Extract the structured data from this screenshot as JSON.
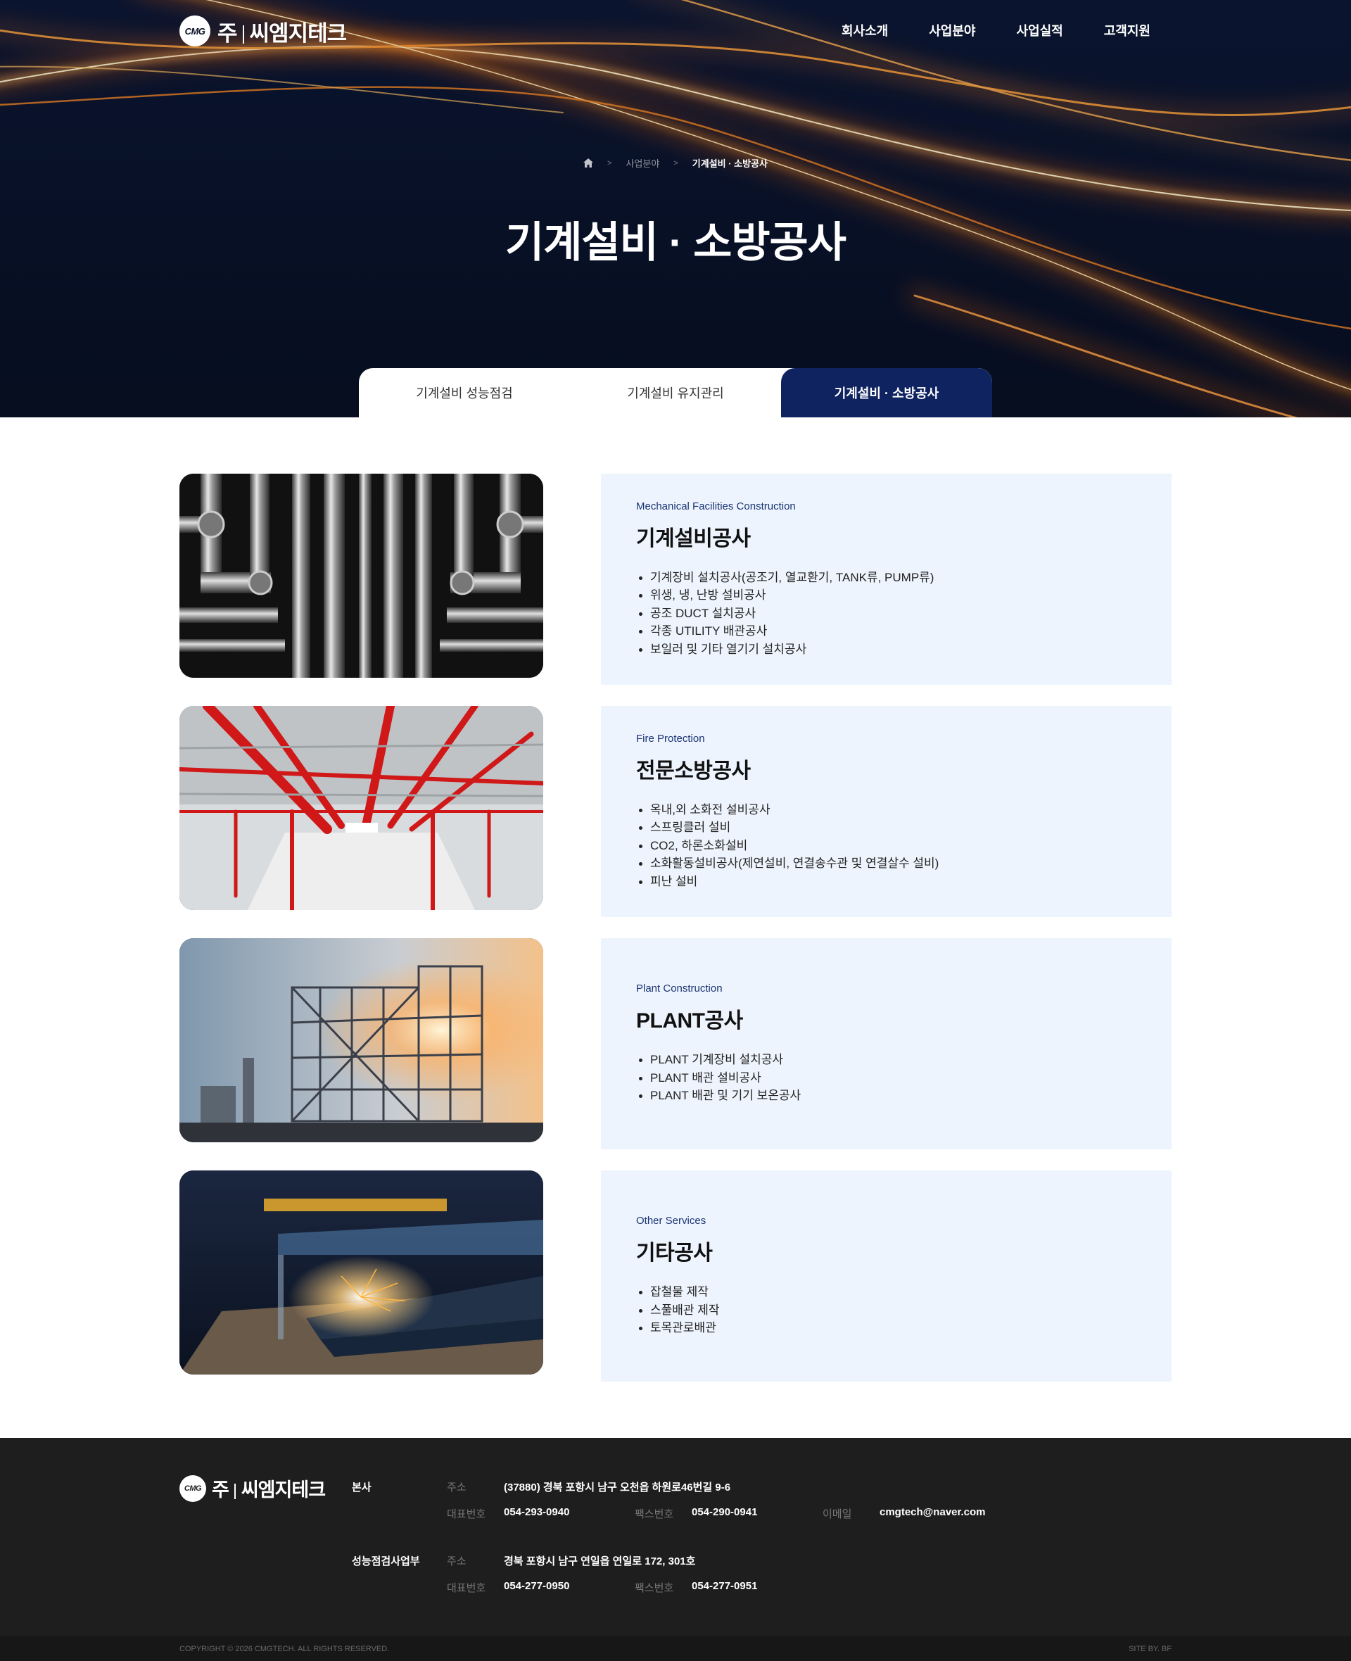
{
  "header": {
    "logo_mark": "CMG",
    "logo_text": "주",
    "logo_name": "씨엠지테크",
    "nav": [
      "회사소개",
      "사업분야",
      "사업실적",
      "고객지원"
    ]
  },
  "breadcrumb": {
    "items": [
      "사업분야",
      "기계설비 · 소방공사"
    ]
  },
  "page_title": "기계설비 · 소방공사",
  "tabs": [
    {
      "label": "기계설비 성능점검",
      "active": false
    },
    {
      "label": "기계설비 유지관리",
      "active": false
    },
    {
      "label": "기계설비 · 소방공사",
      "active": true
    }
  ],
  "services": [
    {
      "subtitle": "Mechanical Facilities Construction",
      "title": "기계설비공사",
      "items": [
        "기계장비 설치공사(공조기, 열교환기, TANK류, PUMP류)",
        "위생, 냉, 난방 설비공사",
        "공조 DUCT 설치공사",
        "각종 UTILITY 배관공사",
        "보일러 및 기타 열기기 설치공사"
      ]
    },
    {
      "subtitle": "Fire Protection",
      "title": "전문소방공사",
      "items": [
        "옥내,외 소화전 설비공사",
        "스프링클러 설비",
        "CO2, 하론소화설비",
        "소화활동설비공사(제연설비, 연결송수관 및 연결살수 설비)",
        "피난 설비"
      ]
    },
    {
      "subtitle": "Plant Construction",
      "title": "PLANT공사",
      "items": [
        "PLANT 기계장비 설치공사",
        "PLANT 배관 설비공사",
        "PLANT 배관 및 기기 보온공사"
      ]
    },
    {
      "subtitle": "Other Services",
      "title": "기타공사",
      "items": [
        "잡철물 제작",
        "스풀배관 제작",
        "토목관로배관"
      ]
    }
  ],
  "footer": {
    "hq": {
      "name": "본사",
      "address_label": "주소",
      "address": "(37880) 경북 포항시 남구 오천읍 하원로46번길 9-6",
      "phone_label": "대표번호",
      "phone": "054-293-0940",
      "fax_label": "팩스번호",
      "fax": "054-290-0941",
      "email_label": "이메일",
      "email": "cmgtech@naver.com"
    },
    "branch": {
      "name": "성능점검사업부",
      "address_label": "주소",
      "address": "경북 포항시 남구 연일읍 연일로 172, 301호",
      "phone_label": "대표번호",
      "phone": "054-277-0950",
      "fax_label": "팩스번호",
      "fax": "054-277-0951"
    },
    "copyright": "COPYRIGHT © 2026 CMGTECH. ALL RIGHTS RESERVED.",
    "site_by": "SITE BY. BF"
  },
  "colors": {
    "hero_bg": "#0a1126",
    "accent_navy": "#0f2361",
    "service_box": "#eef4fd",
    "footer_bg": "#1e1e1e"
  }
}
